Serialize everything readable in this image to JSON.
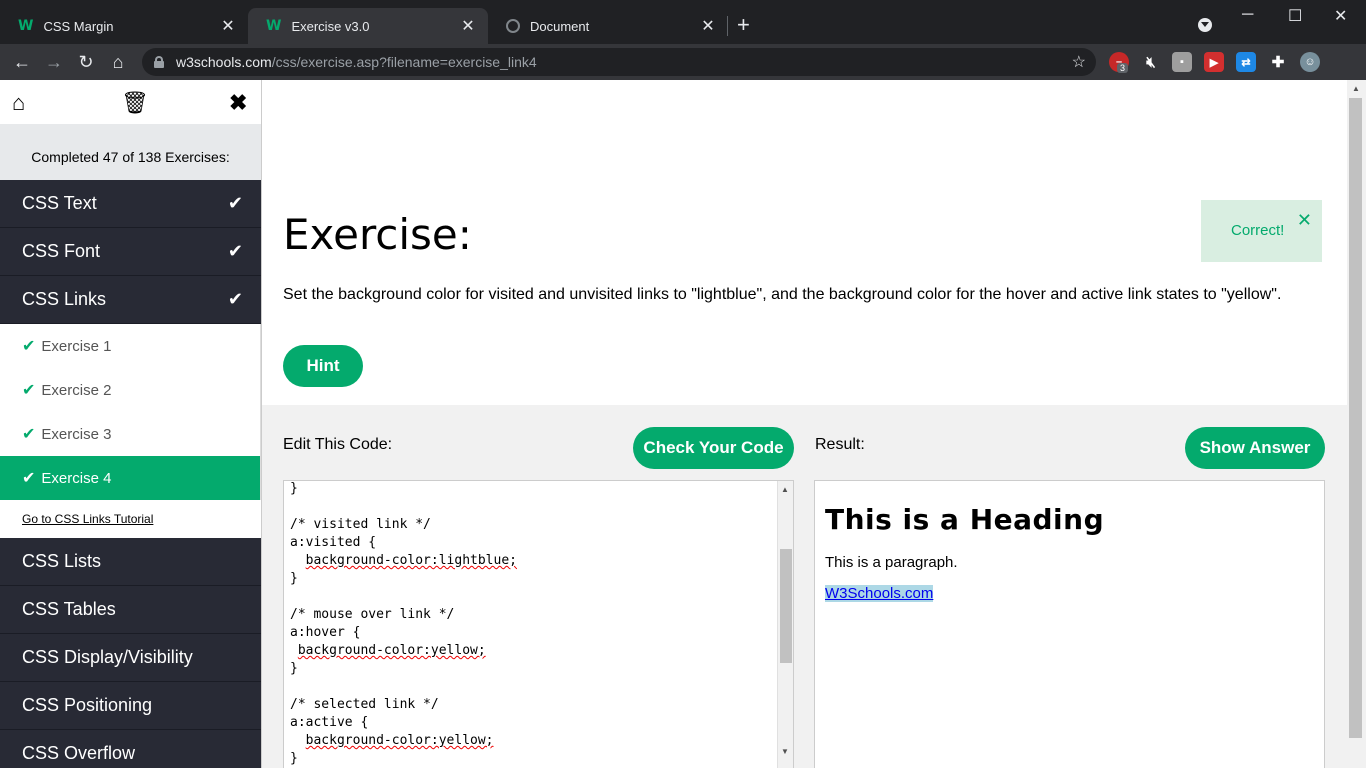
{
  "browser": {
    "tabs": [
      {
        "title": "CSS Margin",
        "active": false,
        "favicon": "w3schools-icon"
      },
      {
        "title": "Exercise v3.0",
        "active": true,
        "favicon": "w3schools-icon"
      },
      {
        "title": "Document",
        "active": false,
        "favicon": "globe-icon"
      }
    ],
    "url_host": "w3schools.com",
    "url_path": "/css/exercise.asp?filename=exercise_link4",
    "extension_badge": "3"
  },
  "sidebar": {
    "progress_text": "Completed 47 of 138 Exercises:",
    "categories_top": [
      {
        "label": "CSS Text",
        "completed": true
      },
      {
        "label": "CSS Font",
        "completed": true
      },
      {
        "label": "CSS Links",
        "completed": true
      }
    ],
    "exercises": [
      {
        "label": "Exercise 1",
        "active": false
      },
      {
        "label": "Exercise 2",
        "active": false
      },
      {
        "label": "Exercise 3",
        "active": false
      },
      {
        "label": "Exercise 4",
        "active": true
      }
    ],
    "tutorial_link": "Go to CSS Links Tutorial",
    "categories_bottom": [
      {
        "label": "CSS Lists"
      },
      {
        "label": "CSS Tables"
      },
      {
        "label": "CSS Display/Visibility"
      },
      {
        "label": "CSS Positioning"
      },
      {
        "label": "CSS Overflow"
      }
    ]
  },
  "exercise": {
    "title": "Exercise:",
    "feedback": "Correct!",
    "description": "Set the background color for visited and unvisited links to \"lightblue\", and the background color for the hover and active link states to \"yellow\".",
    "hint_label": "Hint",
    "edit_label": "Edit This Code:",
    "check_label": "Check Your Code",
    "result_label": "Result:",
    "answer_label": "Show Answer"
  },
  "code_lines": [
    {
      "text": "}"
    },
    {
      "text": ""
    },
    {
      "text": "/* visited link */"
    },
    {
      "text": "a:visited {"
    },
    {
      "indent": "  ",
      "text": "background-color:lightblue;",
      "err": true
    },
    {
      "text": "}"
    },
    {
      "text": ""
    },
    {
      "text": "/* mouse over link */"
    },
    {
      "text": "a:hover {"
    },
    {
      "indent": " ",
      "text": "background-color:yellow;",
      "err": true
    },
    {
      "text": "}"
    },
    {
      "text": ""
    },
    {
      "text": "/* selected link */"
    },
    {
      "text": "a:active {"
    },
    {
      "indent": "  ",
      "text": "background-color:yellow;",
      "err": true
    },
    {
      "text": "}"
    }
  ],
  "result": {
    "heading": "This is a Heading",
    "paragraph": "This is a paragraph.",
    "link": "W3Schools.com",
    "link_bg": "lightblue"
  },
  "colors": {
    "accent": "#04aa6d",
    "sidebar_bg": "#282a35",
    "correct_bg": "#d9eee1"
  }
}
